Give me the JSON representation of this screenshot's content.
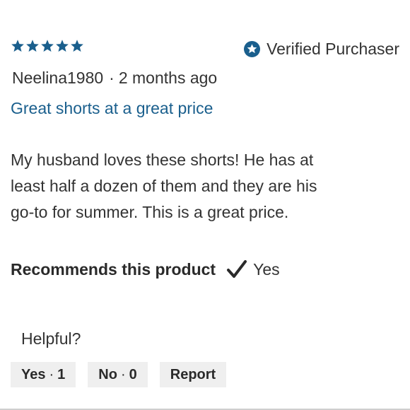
{
  "rating": {
    "value": 5,
    "max": 5,
    "color": "#1a5f8d"
  },
  "verified": {
    "icon": "verified-star-badge-icon",
    "label": "Verified Purchaser"
  },
  "meta": {
    "author": "Neelina1980",
    "separator": "·",
    "date": "2 months ago"
  },
  "review": {
    "title": "Great shorts at a great price",
    "body": "My husband loves these shorts! He has at least half a dozen of them and they are his go-to for summer. This is a great price."
  },
  "recommends": {
    "label": "Recommends this product",
    "icon": "checkmark-icon",
    "value": "Yes"
  },
  "helpful": {
    "label": "Helpful?",
    "yes_label": "Yes",
    "yes_count": "1",
    "no_label": "No",
    "no_count": "0",
    "separator": "·",
    "report_label": "Report"
  },
  "colors": {
    "accent": "#1a5f8d",
    "button_bg": "#efefef",
    "text": "#333333"
  }
}
